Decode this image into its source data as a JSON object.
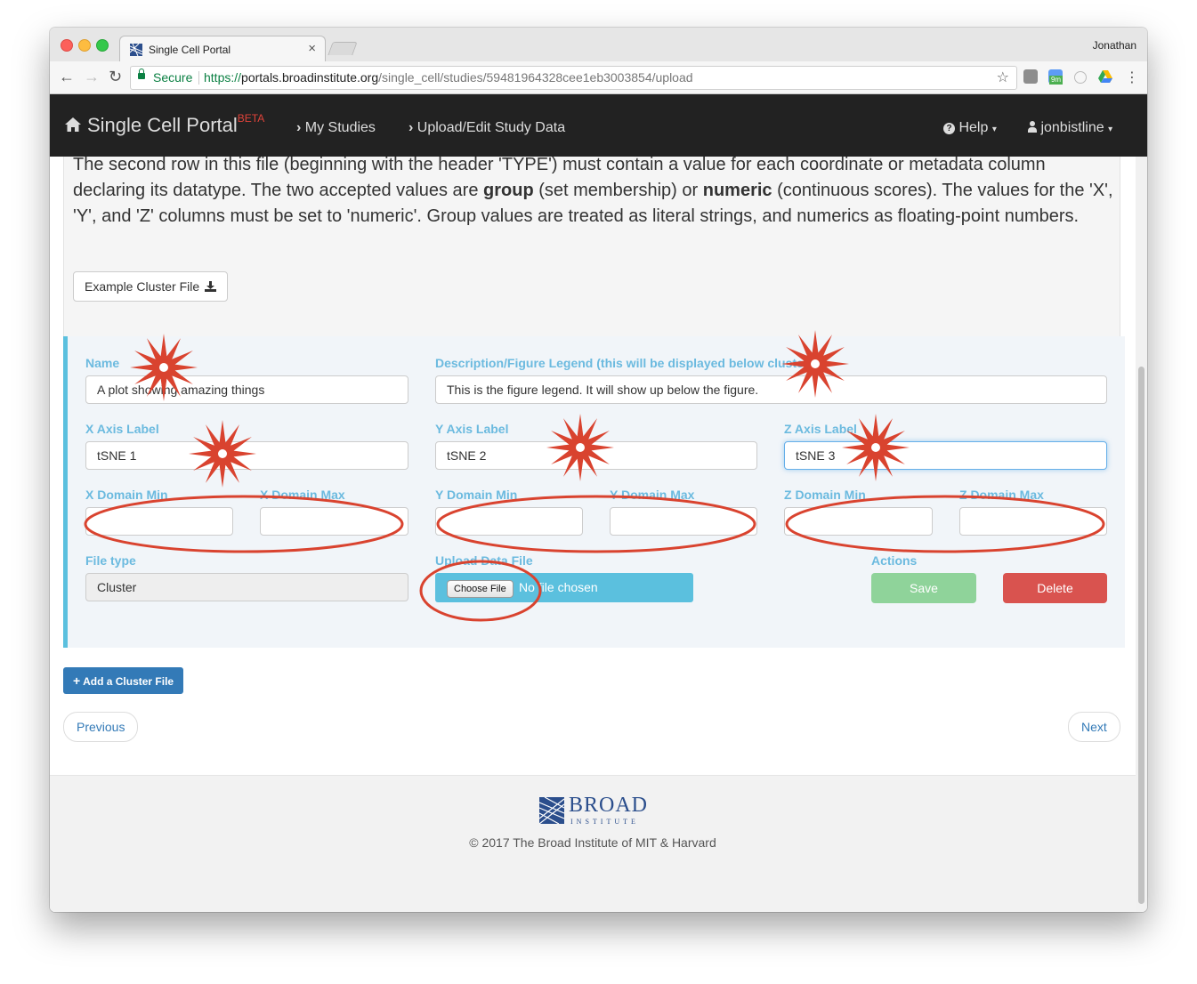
{
  "browser": {
    "tab_title": "Single Cell Portal",
    "tab_close": "×",
    "profile_name": "Jonathan",
    "secure_label": "Secure",
    "url_protocol": "https://",
    "url_host": "portals.broadinstitute.org",
    "url_path": "/single_cell/studies/59481964328cee1eb3003854/upload",
    "back_icon": "←",
    "forward_icon": "→",
    "reload_icon": "↻",
    "bookmark_icon": "☆",
    "menu_icon": "⋮",
    "calendar_badge": "9m"
  },
  "navbar": {
    "brand": "Single Cell Portal",
    "brand_badge": "BETA",
    "home_icon": "home-icon",
    "links": [
      {
        "label": "My Studies"
      },
      {
        "label": "Upload/Edit Study Data"
      }
    ],
    "help": "Help",
    "user": "jonbistline"
  },
  "instructions": {
    "p1": "The second row in this file (beginning with the header 'TYPE') must contain a value for each coordinate or metadata column declaring its datatype. The two accepted values are ",
    "group": "group",
    "p2": " (set membership) or ",
    "numeric": "numeric",
    "p3": " (continuous scores). The values for the 'X', 'Y', and 'Z' columns must be set to 'numeric'. Group values are treated as literal strings, and numerics as floating-point numbers.",
    "example_button": "Example Cluster File"
  },
  "form": {
    "name_label": "Name",
    "name_value": "A plot showing amazing things",
    "description_label": "Description/Figure Legend (this will be displayed below cluster",
    "description_value": "This is the figure legend.  It will show up below the figure.",
    "x_axis_label": "X Axis Label",
    "x_axis_value": "tSNE 1",
    "y_axis_label": "Y Axis Label",
    "y_axis_value": "tSNE 2",
    "z_axis_label": "Z Axis Label",
    "z_axis_value": "tSNE 3",
    "x_domain_min": "X Domain Min",
    "x_domain_max": "X Domain Max",
    "y_domain_min": "Y Domain Min",
    "y_domain_max": "Y Domain Max",
    "z_domain_min": "Z Domain Min",
    "z_domain_max": "Z Domain Max",
    "file_type_label": "File type",
    "file_type_value": "Cluster",
    "upload_label": "Upload Data File",
    "choose_file": "Choose File",
    "no_file": "No file chosen",
    "actions_label": "Actions",
    "save": "Save",
    "delete": "Delete"
  },
  "buttons": {
    "add_cluster": "Add a Cluster File",
    "previous": "Previous",
    "next": "Next"
  },
  "footer": {
    "logo_word": "BROAD",
    "logo_sub": "INSTITUTE",
    "copyright": "© 2017 The Broad Institute of MIT & Harvard"
  },
  "colors": {
    "navbar_bg": "#222222",
    "label_blue": "#6bbadf",
    "panel_accent": "#5bc0de",
    "annotation_red": "#d9432f",
    "save_green": "#8fd39a",
    "delete_red": "#d9534f",
    "primary_blue": "#337ab7"
  }
}
